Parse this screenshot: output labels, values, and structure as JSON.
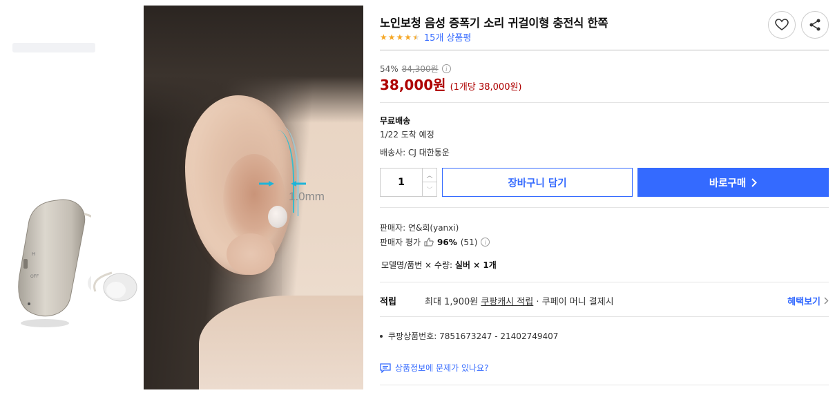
{
  "product": {
    "title": "노인보청 음성 증폭기 소리 귀걸이형 충전식 한쪽",
    "rating": 4.5,
    "review_count_label": "15개 상품평"
  },
  "image": {
    "measurement_label": "1.0mm"
  },
  "price": {
    "discount_rate": "54%",
    "original_price": "84,300원",
    "sale_price": "38,000원",
    "unit_price": "(1개당 38,000원)"
  },
  "shipping": {
    "title": "무료배송",
    "eta": "1/22 도착 예정",
    "carrier": "배송사: CJ 대한통운"
  },
  "purchase": {
    "quantity": "1",
    "cart_label": "장바구니 담기",
    "buy_label": "바로구매"
  },
  "seller": {
    "name_line": "판매자: 연&희(yanxi)",
    "rating_label": "판매자 평가",
    "rating_value": "96%",
    "rating_count": "(51)"
  },
  "option": {
    "prefix": "모델명/품번 × 수량:",
    "value": "실버 × 1개"
  },
  "points": {
    "label": "적립",
    "text_prefix": "최대 1,900원",
    "text_link": "쿠팡캐시 적립",
    "text_suffix": "· 쿠페이 머니 결제시",
    "benefit_label": "혜택보기"
  },
  "product_code": "쿠팡상품번호: 7851673247 - 21402749407",
  "report_label": "상품정보에 문제가 있나요?",
  "colors": {
    "accent": "#346aff",
    "price_red": "#ae0000",
    "star": "#f5a623"
  },
  "icons": [
    "heart-icon",
    "share-icon",
    "info-icon",
    "thumbs-up-icon",
    "chevron-right-icon",
    "report-icon"
  ]
}
